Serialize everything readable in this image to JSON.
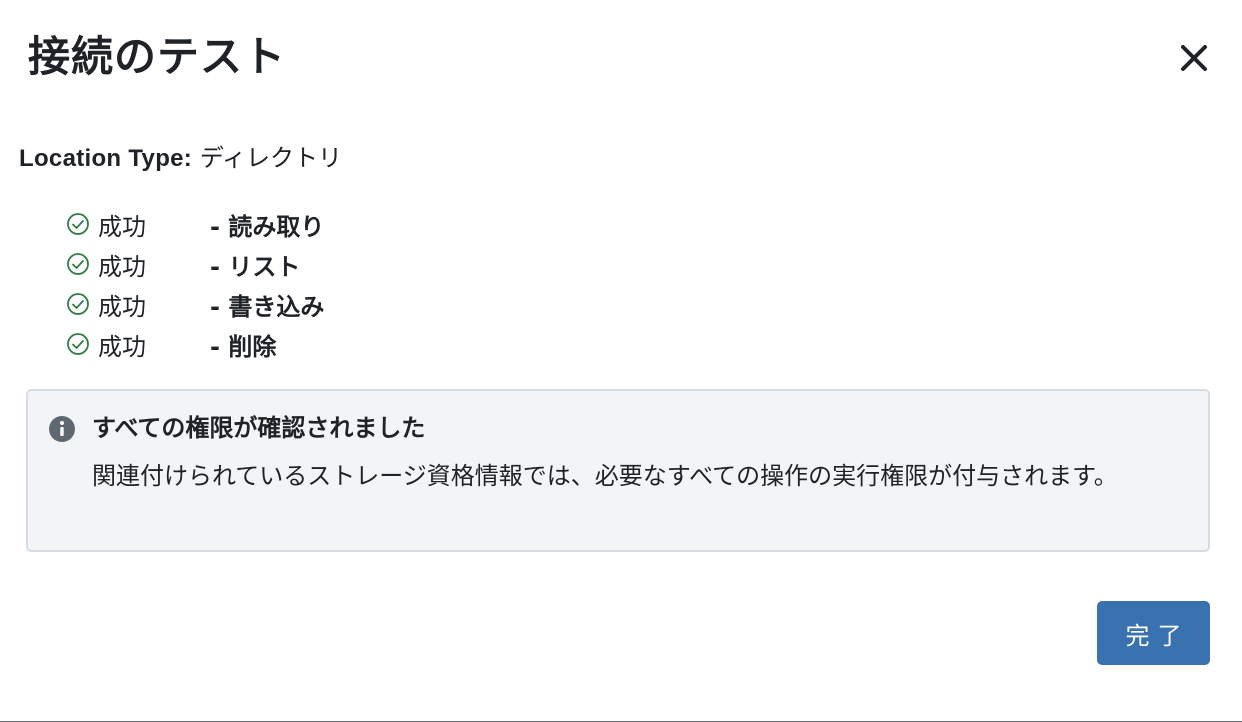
{
  "dialog": {
    "title": "接続のテスト",
    "close_icon": "close-icon"
  },
  "location": {
    "label": "Location Type:",
    "value": "ディレクトリ"
  },
  "checks": [
    {
      "status": "成功",
      "permission": "- 読み取り",
      "icon": "check-circle-icon",
      "color": "#2f7d45"
    },
    {
      "status": "成功",
      "permission": "- リスト",
      "icon": "check-circle-icon",
      "color": "#2f7d45"
    },
    {
      "status": "成功",
      "permission": "- 書き込み",
      "icon": "check-circle-icon",
      "color": "#2f7d45"
    },
    {
      "status": "成功",
      "permission": "- 削除",
      "icon": "check-circle-icon",
      "color": "#2f7d45"
    }
  ],
  "info": {
    "icon": "info-icon",
    "title": "すべての権限が確認されました",
    "body": "関連付けられているストレージ資格情報では、必要なすべての操作の実行権限が付与されます。"
  },
  "footer": {
    "done_label": "完了"
  },
  "colors": {
    "primary_button": "#3a72b0",
    "success": "#2f7d45",
    "info_bg": "#f2f4f6",
    "info_border": "#d6dce2"
  }
}
